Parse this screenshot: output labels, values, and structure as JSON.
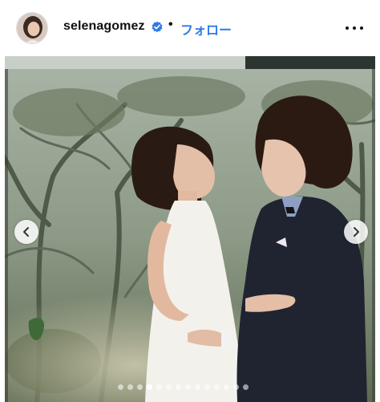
{
  "post": {
    "username": "selenagomez",
    "separator": "•",
    "follow_label": "フォロー",
    "verified": true,
    "accent_color": "#2f7be8",
    "icons": {
      "verified": "verified-badge-icon",
      "more": "more-options-icon",
      "prev": "chevron-left-icon",
      "next": "chevron-right-icon"
    }
  },
  "carousel": {
    "slide_count": 14,
    "active_index": 3
  }
}
